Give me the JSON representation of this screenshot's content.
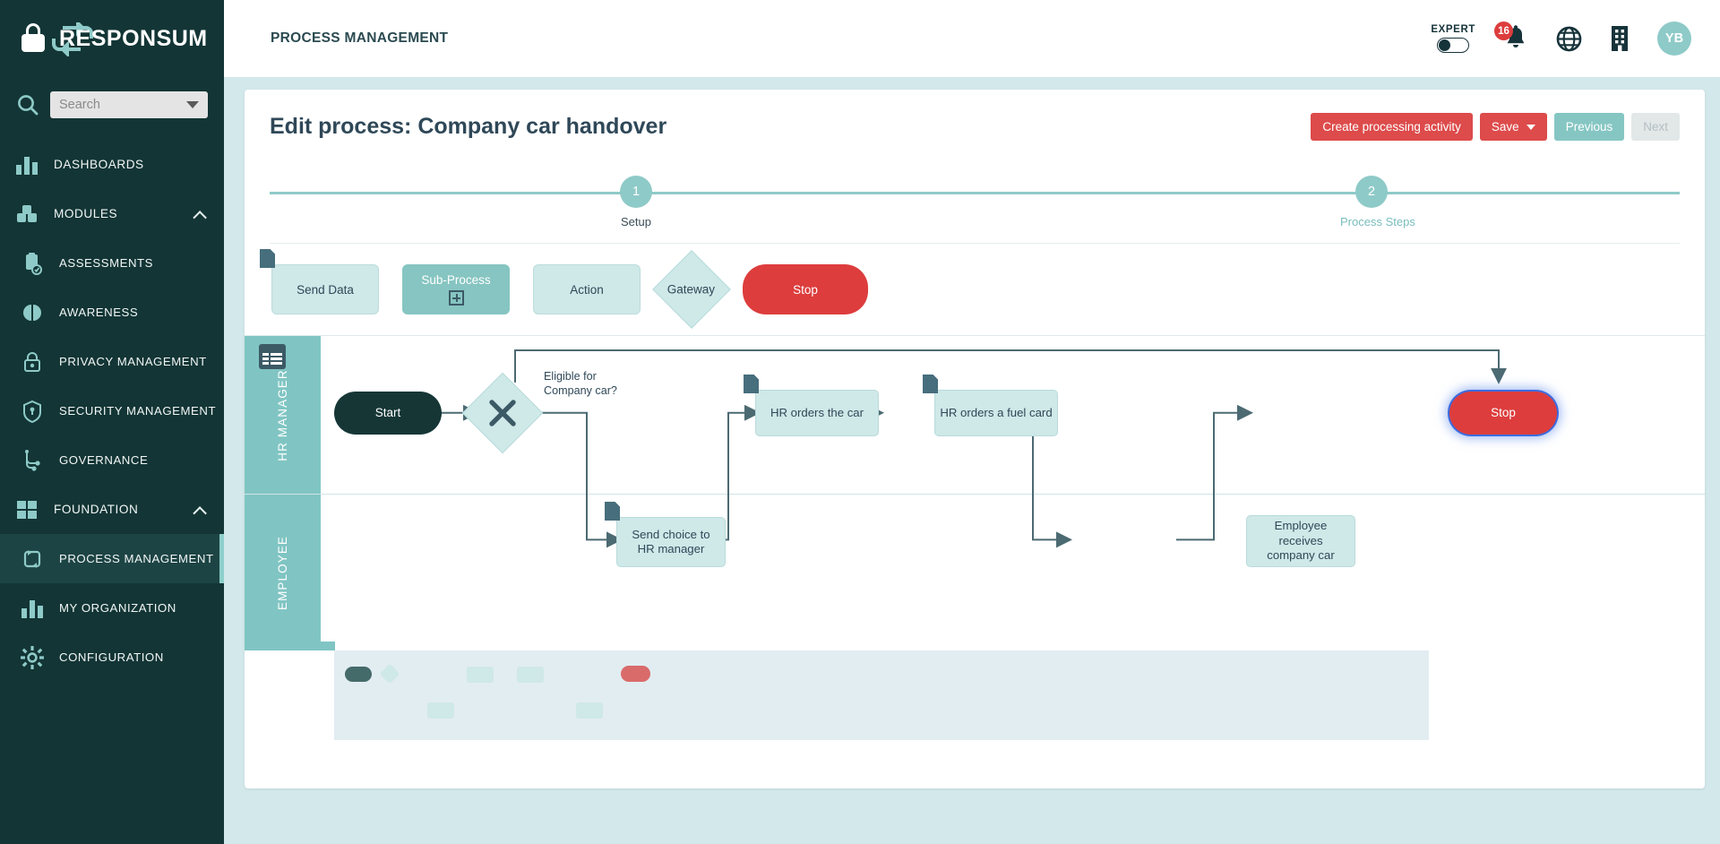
{
  "brand": {
    "name": "RESPONSUM",
    "lock_icon": "lock-icon"
  },
  "sidebar": {
    "search": {
      "placeholder": "Search",
      "value": "",
      "icon": "search-icon",
      "chevron": "chevron-down-icon"
    },
    "items": [
      {
        "label": "DASHBOARDS",
        "icon": "bar-chart-icon",
        "level": "top",
        "active": false,
        "expandable": false
      },
      {
        "label": "MODULES",
        "icon": "modules-icon",
        "level": "top",
        "active": false,
        "expandable": true
      },
      {
        "label": "ASSESSMENTS",
        "icon": "clipboard-check-icon",
        "level": "sub",
        "active": false,
        "expandable": false
      },
      {
        "label": "AWARENESS",
        "icon": "brain-icon",
        "level": "sub",
        "active": false,
        "expandable": false
      },
      {
        "label": "PRIVACY MANAGEMENT",
        "icon": "padlock-icon",
        "level": "sub",
        "active": false,
        "expandable": false
      },
      {
        "label": "SECURITY MANAGEMENT",
        "icon": "shield-icon",
        "level": "sub",
        "active": false,
        "expandable": false
      },
      {
        "label": "GOVERNANCE",
        "icon": "hierarchy-icon",
        "level": "sub",
        "active": false,
        "expandable": false
      },
      {
        "label": "FOUNDATION",
        "icon": "grid-icon",
        "level": "top",
        "active": false,
        "expandable": true
      },
      {
        "label": "PROCESS MANAGEMENT",
        "icon": "process-loop-icon",
        "level": "sub",
        "active": true,
        "expandable": false
      },
      {
        "label": "MY ORGANIZATION",
        "icon": "bar-chart-icon",
        "level": "sub",
        "active": false,
        "expandable": false
      },
      {
        "label": "CONFIGURATION",
        "icon": "gear-icon",
        "level": "sub",
        "active": false,
        "expandable": false
      }
    ]
  },
  "topbar": {
    "breadcrumb": "PROCESS MANAGEMENT",
    "expert_label": "EXPERT",
    "expert_enabled": false,
    "notifications_count": "16",
    "icons": [
      "bell-icon",
      "globe-icon",
      "building-icon"
    ],
    "avatar_initials": "YB"
  },
  "page": {
    "title": "Edit process: Company car handover",
    "buttons": {
      "create": "Create processing activity",
      "save": "Save",
      "previous": "Previous",
      "next": "Next"
    }
  },
  "stepper": {
    "steps": [
      {
        "number": "1",
        "label": "Setup",
        "current": false
      },
      {
        "number": "2",
        "label": "Process Steps",
        "current": true
      }
    ]
  },
  "palette": [
    {
      "label": "Send Data",
      "type": "task",
      "style": "light",
      "doc_badge": true
    },
    {
      "label": "Sub-Process",
      "type": "subprocess",
      "style": "dark",
      "plus": true
    },
    {
      "label": "Action",
      "type": "task",
      "style": "light"
    },
    {
      "label": "Gateway",
      "type": "gateway",
      "style": "diamond"
    },
    {
      "label": "Stop",
      "type": "end",
      "style": "red"
    }
  ],
  "diagram": {
    "lanes": [
      {
        "label": "HR MANAGER"
      },
      {
        "label": "EMPLOYEE"
      }
    ],
    "table_icon": "table-icon",
    "gateway_label": "Eligible for\nCompany car?",
    "gateway_label_line1": "Eligible for",
    "gateway_label_line2": "Company car?",
    "nodes": [
      {
        "id": "start",
        "label": "Start",
        "lane": "HR MANAGER",
        "kind": "start"
      },
      {
        "id": "gateway",
        "label": "",
        "lane": "HR MANAGER",
        "kind": "gateway"
      },
      {
        "id": "order-car",
        "label": "HR orders the car",
        "lane": "HR MANAGER",
        "kind": "task",
        "doc_badge": true
      },
      {
        "id": "fuel-card",
        "label": "HR orders a fuel card",
        "lane": "HR MANAGER",
        "kind": "task",
        "doc_badge": true
      },
      {
        "id": "stop",
        "label": "Stop",
        "lane": "HR MANAGER",
        "kind": "end",
        "selected": true
      },
      {
        "id": "send-choice",
        "label": "Send choice to HR manager",
        "lane": "EMPLOYEE",
        "kind": "task",
        "doc_badge": true
      },
      {
        "id": "receives-car",
        "label": "Employee receives company car",
        "lane": "EMPLOYEE",
        "kind": "task"
      }
    ]
  },
  "colors": {
    "sidebar": "#133535",
    "accent_teal": "#8ecac8",
    "lane_teal": "#80c5c3",
    "danger_red": "#dd3d3d",
    "node_fill": "#cfe8e8",
    "page_bg": "#d2e8ea",
    "selection_blue": "#3b6ce0"
  }
}
